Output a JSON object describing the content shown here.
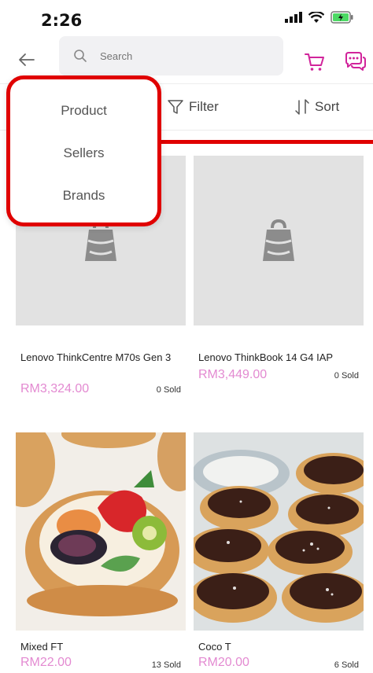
{
  "status_bar": {
    "time": "2:26"
  },
  "header": {
    "search_placeholder": "Search"
  },
  "toolbar": {
    "filter_label": "Filter",
    "sort_label": "Sort"
  },
  "dropdown": {
    "items": [
      "Product",
      "Sellers",
      "Brands"
    ]
  },
  "colors": {
    "accent": "#d1249b",
    "price": "#e38ad1",
    "highlight": "#e00000"
  },
  "products": [
    {
      "name": "Lenovo ThinkCentre M70s Gen 3",
      "price": "RM3,324.00",
      "sold": "0 Sold",
      "image": "placeholder-bag-icon"
    },
    {
      "name": "Lenovo ThinkBook 14 G4 IAP",
      "price": "RM3,449.00",
      "sold": "0 Sold",
      "image": "placeholder-bag-icon"
    },
    {
      "name": "Mixed FT",
      "price": "RM22.00",
      "sold": "13 Sold",
      "image": "fruit-tart-photo"
    },
    {
      "name": "Coco T",
      "price": "RM20.00",
      "sold": "6 Sold",
      "image": "chocolate-tart-photo"
    }
  ]
}
